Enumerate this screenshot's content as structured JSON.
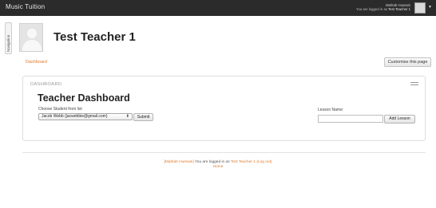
{
  "header": {
    "site_name": "Music Tuition",
    "user_name": "Mahtab Hussain",
    "logged_in_prefix": "You are logged in as",
    "logged_in_user": "Test Teacher 1"
  },
  "nav_tab": {
    "label": "Navigation"
  },
  "page": {
    "title": "Test Teacher 1",
    "breadcrumb": "Dashboard",
    "customise_label": "Customise this page"
  },
  "block": {
    "header": "DASHBOARD",
    "title": "Teacher Dashboard",
    "choose_label": "Choose Student from list",
    "student_selected": "Jacob Webb (jacwebbie@gmail.com)",
    "submit_label": "Submit",
    "lesson_label": "Lesson Name:",
    "lesson_value": "",
    "add_lesson_label": "Add Lesson"
  },
  "footer": {
    "user_link": "[Mahtab Hussain]",
    "logged_text": "You are logged in as",
    "teacher_link": "Test Teacher 1",
    "logout_link": "(Log out)",
    "home_link": "Home"
  }
}
